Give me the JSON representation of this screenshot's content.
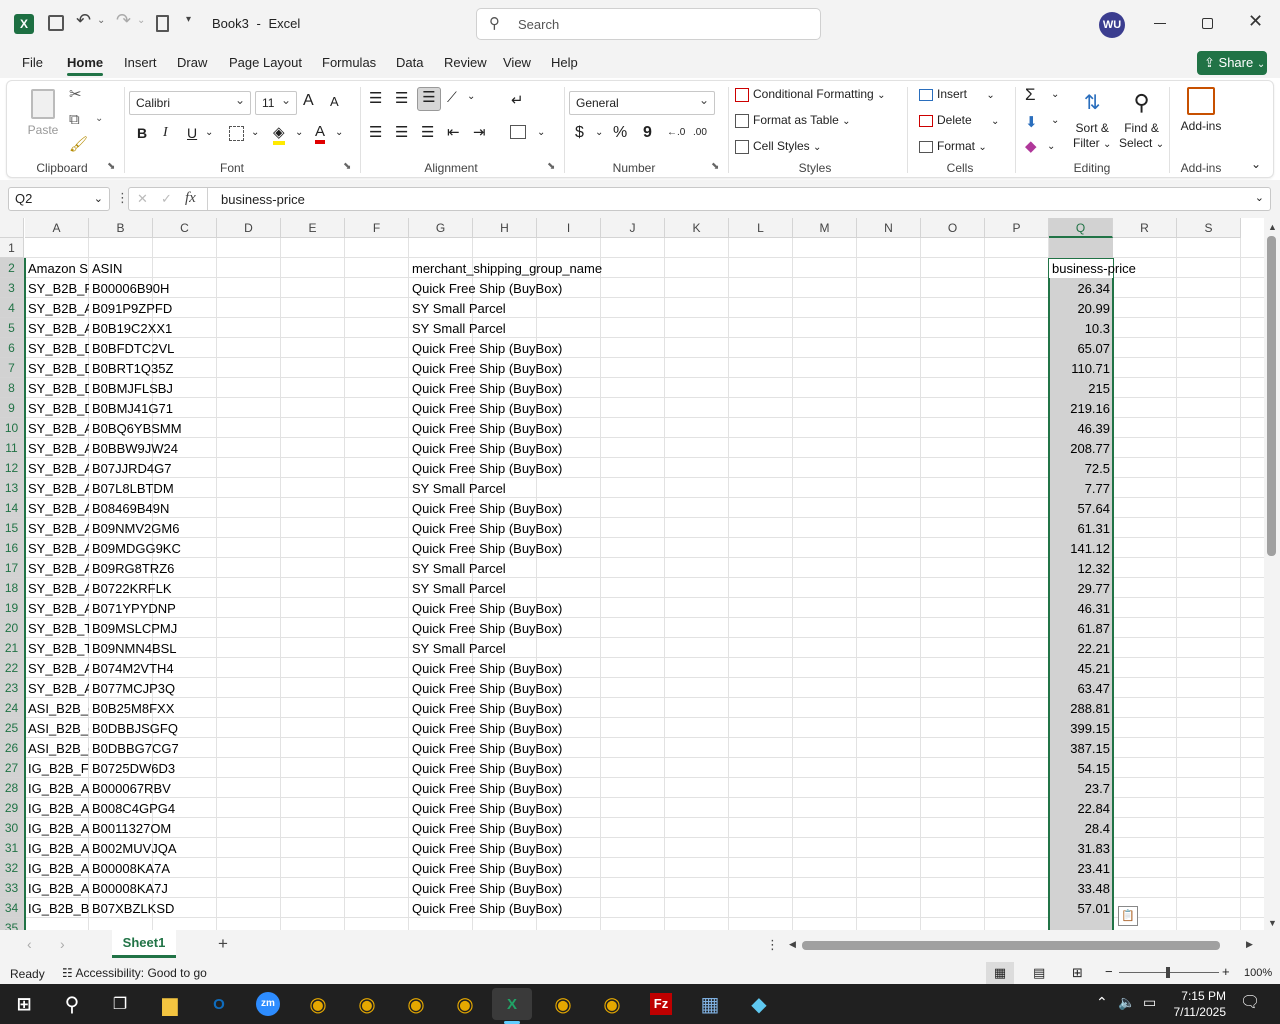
{
  "title": {
    "doc": "Book3",
    "sep": "-",
    "app": "Excel",
    "search_placeholder": "Search",
    "user_initials": "WU"
  },
  "tabs": [
    "File",
    "Home",
    "Insert",
    "Draw",
    "Page Layout",
    "Formulas",
    "Data",
    "Review",
    "View",
    "Help"
  ],
  "share_label": "Share",
  "ribbon": {
    "clipboard": {
      "label": "Clipboard",
      "paste": "Paste"
    },
    "font": {
      "label": "Font",
      "name": "Calibri",
      "size": "11",
      "bold": "B",
      "italic": "I",
      "underline": "U",
      "grow": "A",
      "shrink": "A"
    },
    "alignment": {
      "label": "Alignment"
    },
    "number": {
      "label": "Number",
      "format": "General",
      "currency": "$",
      "percent": "%",
      "comma": "9"
    },
    "styles": {
      "label": "Styles",
      "cond": "Conditional Formatting",
      "table": "Format as Table",
      "cell": "Cell Styles"
    },
    "cells": {
      "label": "Cells",
      "insert": "Insert",
      "delete": "Delete",
      "format": "Format"
    },
    "editing": {
      "label": "Editing",
      "sort1": "Sort &",
      "sort2": "Filter",
      "find1": "Find &",
      "find2": "Select"
    },
    "addins": {
      "label": "Add-ins",
      "btn": "Add-ins"
    }
  },
  "formula": {
    "namebox": "Q2",
    "fx": "fx",
    "content": "business-price"
  },
  "columns": [
    "A",
    "B",
    "C",
    "D",
    "E",
    "F",
    "G",
    "H",
    "I",
    "J",
    "K",
    "L",
    "M",
    "N",
    "O",
    "P",
    "Q",
    "R",
    "S"
  ],
  "headers": {
    "a": "Amazon S",
    "b": "ASIN",
    "g": "merchant_shipping_group_name",
    "q": "business-price"
  },
  "rows": [
    {
      "n": "3",
      "a": "SY_B2B_P",
      "b": "B00006B90H",
      "g": "Quick Free Ship (BuyBox)",
      "q": "26.34"
    },
    {
      "n": "4",
      "a": "SY_B2B_A",
      "b": "B091P9ZPFD",
      "g": "SY Small Parcel",
      "q": "20.99"
    },
    {
      "n": "5",
      "a": "SY_B2B_A",
      "b": "B0B19C2XX1",
      "g": "SY Small Parcel",
      "q": "10.3"
    },
    {
      "n": "6",
      "a": "SY_B2B_D",
      "b": "B0BFDTC2VL",
      "g": "Quick Free Ship (BuyBox)",
      "q": "65.07"
    },
    {
      "n": "7",
      "a": "SY_B2B_D",
      "b": "B0BRT1Q35Z",
      "g": "Quick Free Ship (BuyBox)",
      "q": "110.71"
    },
    {
      "n": "8",
      "a": "SY_B2B_D",
      "b": "B0BMJFLSBJ",
      "g": "Quick Free Ship (BuyBox)",
      "q": "215"
    },
    {
      "n": "9",
      "a": "SY_B2B_D",
      "b": "B0BMJ41G71",
      "g": "Quick Free Ship (BuyBox)",
      "q": "219.16"
    },
    {
      "n": "10",
      "a": "SY_B2B_A",
      "b": "B0BQ6YBSMM",
      "g": "Quick Free Ship (BuyBox)",
      "q": "46.39"
    },
    {
      "n": "11",
      "a": "SY_B2B_A",
      "b": "B0BBW9JW24",
      "g": "Quick Free Ship (BuyBox)",
      "q": "208.77"
    },
    {
      "n": "12",
      "a": "SY_B2B_A",
      "b": "B07JJRD4G7",
      "g": "Quick Free Ship (BuyBox)",
      "q": "72.5"
    },
    {
      "n": "13",
      "a": "SY_B2B_A",
      "b": "B07L8LBTDM",
      "g": "SY Small Parcel",
      "q": "7.77"
    },
    {
      "n": "14",
      "a": "SY_B2B_A",
      "b": "B08469B49N",
      "g": "Quick Free Ship (BuyBox)",
      "q": "57.64"
    },
    {
      "n": "15",
      "a": "SY_B2B_A",
      "b": "B09NMV2GM6",
      "g": "Quick Free Ship (BuyBox)",
      "q": "61.31"
    },
    {
      "n": "16",
      "a": "SY_B2B_A",
      "b": "B09MDGG9KC",
      "g": "Quick Free Ship (BuyBox)",
      "q": "141.12"
    },
    {
      "n": "17",
      "a": "SY_B2B_A",
      "b": "B09RG8TRZ6",
      "g": "SY Small Parcel",
      "q": "12.32"
    },
    {
      "n": "18",
      "a": "SY_B2B_A",
      "b": "B0722KRFLK",
      "g": "SY Small Parcel",
      "q": "29.77"
    },
    {
      "n": "19",
      "a": "SY_B2B_A",
      "b": "B071YPYDNP",
      "g": "Quick Free Ship (BuyBox)",
      "q": "46.31"
    },
    {
      "n": "20",
      "a": "SY_B2B_TI",
      "b": "B09MSLCPMJ",
      "g": "Quick Free Ship (BuyBox)",
      "q": "61.87"
    },
    {
      "n": "21",
      "a": "SY_B2B_TI",
      "b": "B09NMN4BSL",
      "g": "SY Small Parcel",
      "q": "22.21"
    },
    {
      "n": "22",
      "a": "SY_B2B_A",
      "b": "B074M2VTH4",
      "g": "Quick Free Ship (BuyBox)",
      "q": "45.21"
    },
    {
      "n": "23",
      "a": "SY_B2B_A",
      "b": "B077MCJP3Q",
      "g": "Quick Free Ship (BuyBox)",
      "q": "63.47"
    },
    {
      "n": "24",
      "a": "ASI_B2B_(",
      "b": "B0B25M8FXX",
      "g": "Quick Free Ship (BuyBox)",
      "q": "288.81"
    },
    {
      "n": "25",
      "a": "ASI_B2B_(",
      "b": "B0DBBJSGFQ",
      "g": "Quick Free Ship (BuyBox)",
      "q": "399.15"
    },
    {
      "n": "26",
      "a": "ASI_B2B_(",
      "b": "B0DBBG7CG7",
      "g": "Quick Free Ship (BuyBox)",
      "q": "387.15"
    },
    {
      "n": "27",
      "a": "IG_B2B_F2",
      "b": "B0725DW6D3",
      "g": "Quick Free Ship (BuyBox)",
      "q": "54.15"
    },
    {
      "n": "28",
      "a": "IG_B2B_A:",
      "b": "B000067RBV",
      "g": "Quick Free Ship (BuyBox)",
      "q": "23.7"
    },
    {
      "n": "29",
      "a": "IG_B2B_A:",
      "b": "B008C4GPG4",
      "g": "Quick Free Ship (BuyBox)",
      "q": "22.84"
    },
    {
      "n": "30",
      "a": "IG_B2B_A:",
      "b": "B0011327OM",
      "g": "Quick Free Ship (BuyBox)",
      "q": "28.4"
    },
    {
      "n": "31",
      "a": "IG_B2B_A:",
      "b": "B002MUVJQA",
      "g": "Quick Free Ship (BuyBox)",
      "q": "31.83"
    },
    {
      "n": "32",
      "a": "IG_B2B_A:",
      "b": "B00008KA7A",
      "g": "Quick Free Ship (BuyBox)",
      "q": "23.41"
    },
    {
      "n": "33",
      "a": "IG_B2B_A:",
      "b": "B00008KA7J",
      "g": "Quick Free Ship (BuyBox)",
      "q": "33.48"
    },
    {
      "n": "34",
      "a": "IG_B2B_B:",
      "b": "B07XBZLKSD",
      "g": "Quick Free Ship (BuyBox)",
      "q": "57.01"
    }
  ],
  "sheet": {
    "name": "Sheet1",
    "add": "+"
  },
  "status": {
    "ready": "Ready",
    "access": "Accessibility: Good to go",
    "zoom": "100%"
  },
  "clock": {
    "time": "7:15 PM",
    "date": "7/11/2025"
  },
  "colors": {
    "accent": "#217346",
    "selection": "#d2d2d2"
  }
}
